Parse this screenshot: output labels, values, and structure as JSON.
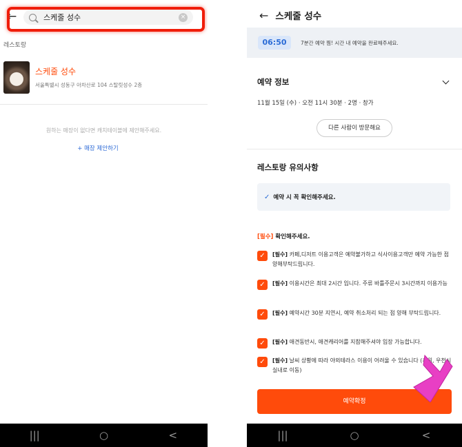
{
  "left_screen": {
    "search": {
      "value": "스케줄 성수"
    },
    "section_label": "레스토랑",
    "result": {
      "name": "스케줄 성수",
      "address": "서울특별시 성동구 아차산로 104 스탈릿성수 2층"
    },
    "empty_message": "원하는 매장이 없다면 캐치테이블에 제안해주세요.",
    "suggest_link": "+ 매장 제안하기",
    "icons": [
      "back-arrow-icon",
      "search-icon",
      "clear-icon",
      "restaurant-thumbnail"
    ]
  },
  "right_screen": {
    "header": {
      "title": "스케줄 성수"
    },
    "timer": {
      "time": "06:50",
      "message": "7분간 예약 찜! 시간 내 예약을 완료해주세요."
    },
    "reservation": {
      "title": "예약 정보",
      "details": "11월 15일 (수) · 오전 11시 30분 · 2명 · 창가",
      "visit_button": "다른 사람이 방문해요"
    },
    "notices": {
      "title": "레스토랑 유의사항",
      "notice": "예약 시 꼭 확인해주세요.",
      "required_tag": "[필수]",
      "required_heading": "확인해주세요.",
      "items": [
        {
          "tag": "[필수]",
          "text": "카페,디저트 이용고객은 예약불가하고 식사이용고객만 예약 가능한 점 양해부탁드립니다."
        },
        {
          "tag": "[필수]",
          "text": "이용시간은 최대 2시간 입니다. 주류 바틀주문시 3시간까지 이용가능"
        },
        {
          "tag": "[필수]",
          "text": "예약시간 30분 지연시, 예약 취소처리 되는 점 양해 부탁드립니다."
        },
        {
          "tag": "[필수]",
          "text": "애견동반시, 애견캐리어를 지참해주셔야 입장 가능합니다."
        },
        {
          "tag": "[필수]",
          "text": "날씨 상황에 따라 야외테라스 이용이 어려울 수 있습니다 (추위, 우천시 실내로 이동)"
        }
      ]
    },
    "confirm_button": "예약확정"
  },
  "nav": {
    "recent": "|||",
    "home": "○",
    "back": "<"
  },
  "colors": {
    "accent": "#ff4b0b",
    "timer_blue": "#2a6bd6",
    "highlight_red": "#f01d0a",
    "pointer_pink": "#e83fc4"
  }
}
